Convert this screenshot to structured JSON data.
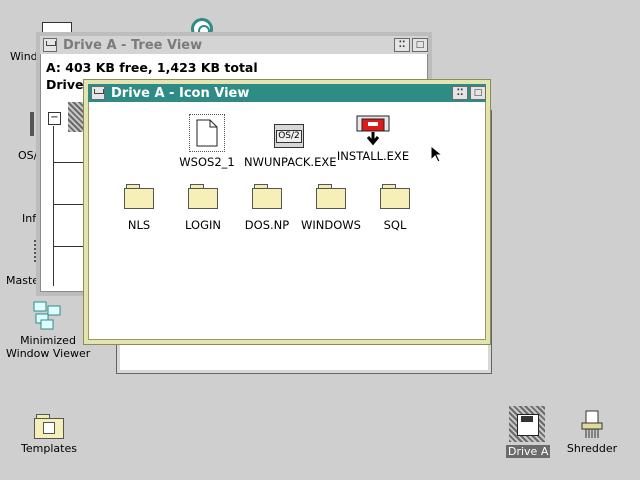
{
  "desktop": {
    "partial_labels": {
      "windows": "Wind",
      "os2": "OS/",
      "info": "Inf",
      "master": "Master"
    },
    "icons": {
      "minimized_viewer": "Minimized\nWindow Viewer",
      "templates": "Templates",
      "drive_a": "Drive A",
      "shredder": "Shredder"
    }
  },
  "tree_view": {
    "title": "Drive A - Tree View",
    "status_line": "A:  403 KB free,  1,423 KB total",
    "second_line": "Drive ."
  },
  "icon_view": {
    "title": "Drive A - Icon View",
    "row1": [
      {
        "label": "WSOS2_1",
        "icon": "document-icon"
      },
      {
        "label": "NWUNPACK.EXE",
        "icon": "os2-program-icon"
      },
      {
        "label": "INSTALL.EXE",
        "icon": "install-icon"
      }
    ],
    "row2": [
      {
        "label": "NLS",
        "icon": "folder-icon"
      },
      {
        "label": "LOGIN",
        "icon": "folder-icon"
      },
      {
        "label": "DOS.NP",
        "icon": "folder-icon"
      },
      {
        "label": "WINDOWS",
        "icon": "folder-icon"
      },
      {
        "label": "SQL",
        "icon": "folder-icon"
      }
    ],
    "os2_badge": "OS/2"
  },
  "colors": {
    "desktop": "#cfcfcf",
    "active_title": "#2f8b86",
    "inactive_title": "#d4d4d4",
    "frame": "#bdbdbd"
  }
}
